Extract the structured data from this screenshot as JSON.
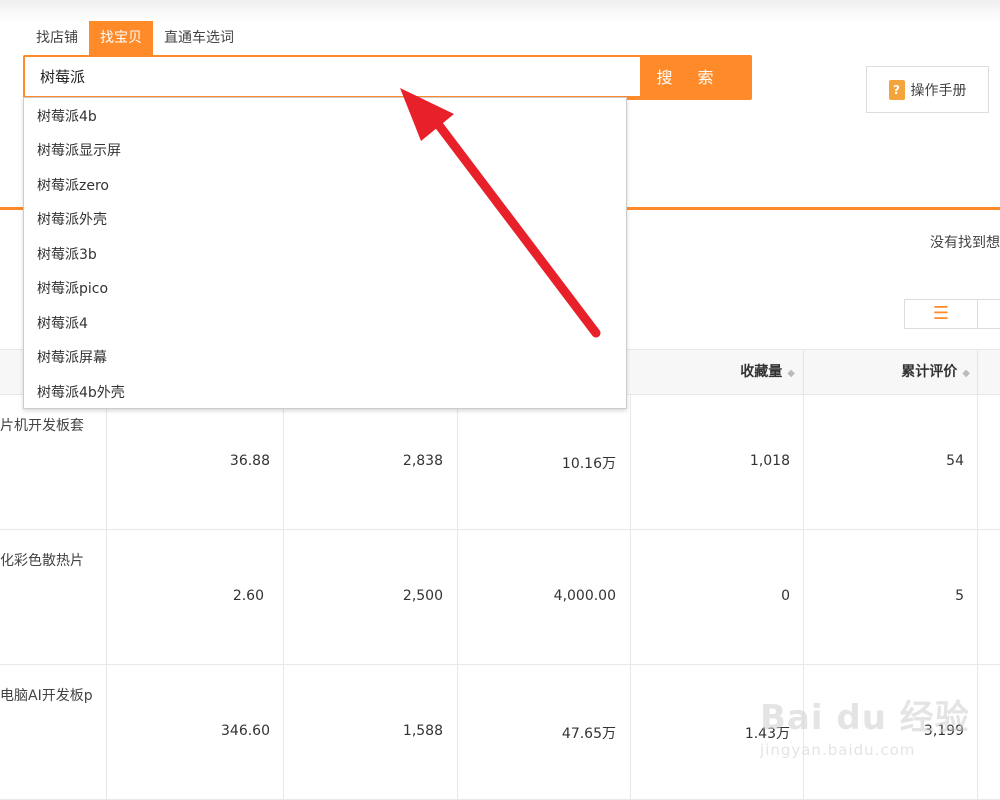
{
  "tabs": [
    {
      "label": "找店铺",
      "active": false
    },
    {
      "label": "找宝贝",
      "active": true
    },
    {
      "label": "直通车选词",
      "active": false
    }
  ],
  "search": {
    "value": "树莓派",
    "button_label": "搜 索"
  },
  "manual": {
    "label": "操作手册",
    "icon": "?"
  },
  "not_found_text": "没有找到想",
  "view_toggle": {
    "list_icon": "☰"
  },
  "suggestions": [
    "树莓派4b",
    "树莓派显示屏",
    "树莓派zero",
    "树莓派外壳",
    "树莓派3b",
    "树莓派pico",
    "树莓派4",
    "树莓派屏幕",
    "树莓派4b外壳"
  ],
  "table": {
    "headers": {
      "favorites": "收藏量",
      "reviews": "累计评价"
    },
    "sort_icon": "◆",
    "rows": [
      {
        "title": "片机开发板套",
        "price": "36.88",
        "sales": "2,838",
        "revenue": "10.16万",
        "favorites": "1,018",
        "reviews": "54"
      },
      {
        "title": "化彩色散热片",
        "price": "2.60",
        "sales": "2,500",
        "revenue": "4,000.00",
        "favorites": "0",
        "reviews": "5"
      },
      {
        "title": "电脑AI开发板p",
        "price": "346.60",
        "sales": "1,588",
        "revenue": "47.65万",
        "favorites": "1.43万",
        "reviews": "3,199"
      }
    ]
  },
  "colors": {
    "accent": "#ff8a2a",
    "arrow": "#e8202a"
  },
  "watermark": {
    "logo": "Bai du 经验",
    "url": "jingyan.baidu.com"
  }
}
